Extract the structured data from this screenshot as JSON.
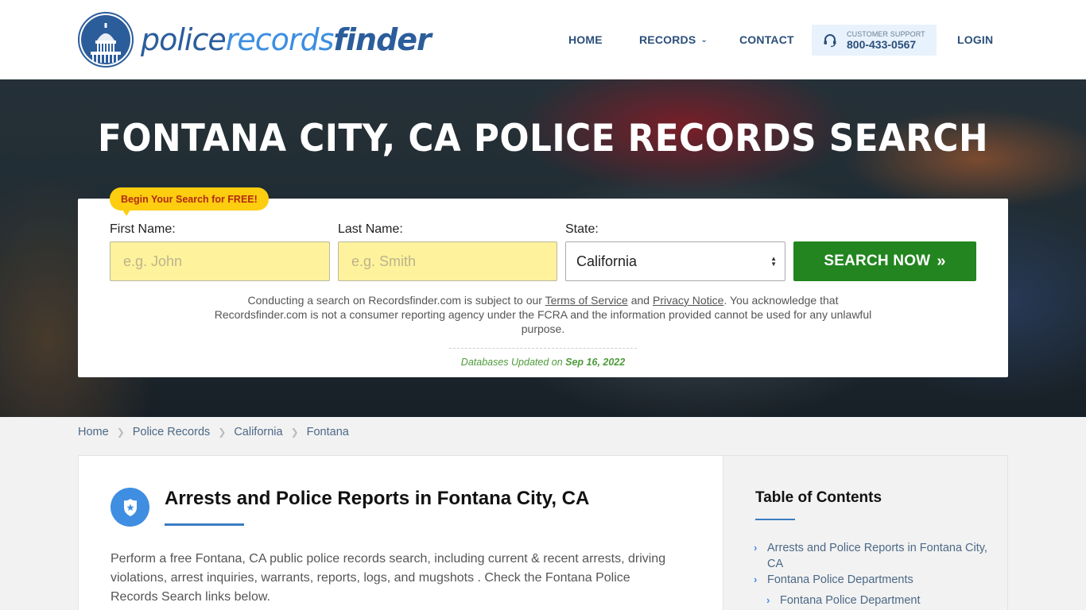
{
  "header": {
    "logo": {
      "part1": "police",
      "part2": "records",
      "part3": "finder"
    },
    "nav": {
      "home": "HOME",
      "records": "RECORDS",
      "contact": "CONTACT",
      "login": "LOGIN"
    },
    "support": {
      "label": "CUSTOMER SUPPORT",
      "phone": "800-433-0567"
    }
  },
  "hero": {
    "title": "FONTANA CITY, CA POLICE RECORDS SEARCH",
    "badge": "Begin Your Search for FREE!",
    "form": {
      "first_name_label": "First Name:",
      "first_name_placeholder": "e.g. John",
      "first_name_value": "",
      "last_name_label": "Last Name:",
      "last_name_placeholder": "e.g. Smith",
      "last_name_value": "",
      "state_label": "State:",
      "state_value": "California",
      "search_button": "SEARCH NOW",
      "search_button_icon": "»"
    },
    "disclaimer": {
      "before": "Conducting a search on Recordsfinder.com is subject to our ",
      "terms_link": "Terms of Service",
      "and": " and ",
      "privacy_link": "Privacy Notice",
      "after": ". You acknowledge that Recordsfinder.com is not a consumer reporting agency under the FCRA and the information provided cannot be used for any unlawful purpose."
    },
    "db_updated_label": "Databases Updated on ",
    "db_updated_date": "Sep 16, 2022"
  },
  "breadcrumb": [
    {
      "label": "Home"
    },
    {
      "label": "Police Records"
    },
    {
      "label": "California"
    },
    {
      "label": "Fontana"
    }
  ],
  "main": {
    "section_title": "Arrests and Police Reports in Fontana City, CA",
    "section_body": "Perform a free Fontana, CA public police records search, including current & recent arrests, driving violations, arrest inquiries, warrants, reports, logs, and mugshots . Check the Fontana Police Records Search links below."
  },
  "toc": {
    "title": "Table of Contents",
    "items": [
      {
        "label": "Arrests and Police Reports in Fontana City, CA",
        "level": 1
      },
      {
        "label": "Fontana Police Departments",
        "level": 1
      },
      {
        "label": "Fontana Police Department",
        "level": 2
      }
    ]
  },
  "colors": {
    "brand_dark": "#2b5d9b",
    "brand_light": "#3c8ee0",
    "nav_text": "#2b4f7b",
    "badge_bg": "#fdcd0f",
    "input_bg": "#fff29c",
    "search_button": "#23851f",
    "db_updated": "#4e9a3a"
  }
}
